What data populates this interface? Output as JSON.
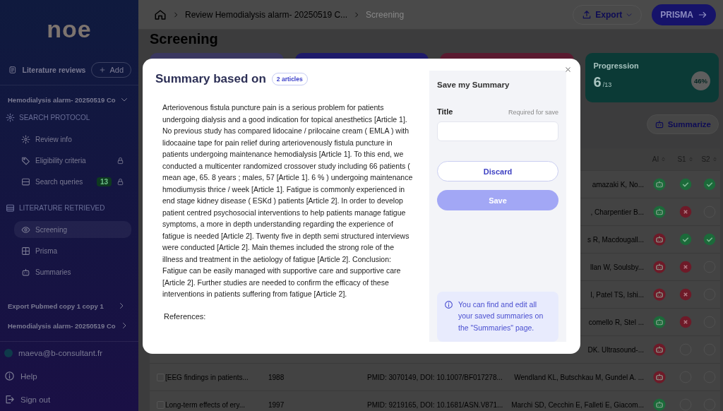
{
  "sidebar": {
    "logo": "noe",
    "reviews_label": "Literature reviews",
    "add_button": "Add",
    "current_review": {
      "title": "Hemodialysis alarm- 20250519 Co",
      "expanded": true,
      "sections": [
        {
          "heading": "SEARCH PROTOCOL",
          "items": [
            {
              "label": "Review info",
              "selected": false,
              "locked": false
            },
            {
              "label": "Eligibility criteria",
              "selected": false,
              "locked": true
            },
            {
              "label": "Search queries",
              "badge": "13",
              "selected": false,
              "locked": true
            }
          ]
        },
        {
          "heading": "LITERATURE RETRIEVED",
          "items": [
            {
              "label": "Screening",
              "selected": true,
              "locked": false
            },
            {
              "label": "Prisma",
              "selected": false,
              "locked": false
            },
            {
              "label": "Summaries",
              "selected": false,
              "locked": false
            }
          ]
        }
      ]
    },
    "other_reviews": [
      {
        "title": "Export Pubmed copy 1 copy 1",
        "expanded": false
      },
      {
        "title": "Hemodialysis alarm- 20250519 Co",
        "expanded": false
      }
    ],
    "user": "maeva@b-consultant.fr",
    "links": [
      "Help",
      "Sign out"
    ]
  },
  "topbar": {
    "breadcrumb": [
      "Review Hemodialysis alarm- 20250519 C...",
      "Screening"
    ],
    "export_button": "Export",
    "prisma_button": "PRISMA"
  },
  "page_title": "Screening",
  "stat_cards": [
    {
      "color": "#3a3760"
    },
    {
      "color": "#1e1a6a"
    },
    {
      "color": "#5a1a30"
    },
    {
      "color": "#0b3a36",
      "label": "Progression",
      "value": "6",
      "total": "/13",
      "percent": "46%"
    }
  ],
  "summarize_button": "Summarize",
  "table": {
    "columns": [
      "AI",
      "S1",
      "S2"
    ],
    "rows": [
      {
        "authors": "amazaki K, No...",
        "verdicts": [
          {
            "kind": "include"
          },
          {
            "kind": "include"
          },
          {
            "kind": "include"
          }
        ]
      },
      {
        "authors": ", Charpentier B...",
        "verdicts": [
          {
            "kind": "include"
          },
          {
            "kind": "exclude"
          },
          {
            "kind": "none"
          }
        ]
      },
      {
        "authors": "s R, Macdougall...",
        "verdicts": [
          {
            "kind": "exclude"
          },
          {
            "kind": "include"
          },
          {
            "kind": "include"
          }
        ]
      },
      {
        "authors": "llan W, Soulsby...",
        "verdicts": [
          {
            "kind": "exclude"
          },
          {
            "kind": "exclude"
          },
          {
            "kind": "none"
          }
        ]
      },
      {
        "authors": "l, Patel TS, Ishi...",
        "verdicts": [
          {
            "kind": "exclude"
          },
          {
            "kind": "exclude"
          },
          {
            "kind": "none"
          }
        ]
      },
      {
        "authors": "comello R, Stel ...",
        "verdicts": [
          {
            "kind": "include"
          },
          {
            "kind": "exclude"
          },
          {
            "kind": "none"
          }
        ]
      },
      {
        "authors": "DK. Ultrasound-...",
        "verdicts": [
          {
            "kind": "exclude"
          },
          {
            "kind": "none"
          },
          {
            "kind": "none"
          }
        ]
      },
      {
        "checked": false,
        "title": "[EEG findings in patients...",
        "year": "1988",
        "ids": "PMID: 3070149, DOI: 10.1007/BF017278...",
        "authors": "Wendland KL, Butschkau M, Gundel A. ...",
        "verdicts": [
          {
            "kind": "exclude"
          },
          {
            "kind": "none"
          },
          {
            "kind": "none"
          }
        ]
      },
      {
        "checked": false,
        "title": "Long-term effects of ery...",
        "year": "1997",
        "ids": "PMID: 9219165, DOI: 10.1681/ASN.V871...",
        "authors": "Marchi SD, Cecchin E, Falleti E, Giacom...",
        "verdicts": [
          {
            "kind": "include"
          },
          {
            "kind": "none"
          },
          {
            "kind": "none"
          }
        ]
      }
    ]
  },
  "modal": {
    "title": "Summary based on",
    "badge": "2 articles",
    "summary": "Arteriovenous fistula puncture pain is a serious problem for patients undergoing dialysis and a good indication for topical anesthetics [Article 1]. No previous study has compared lidocaine / prilocaine cream ( EMLA ) with lidocaaine tape for pain relief during arteriovenously fistula puncture in patients undergoing maintenance hemodialysis [Article 1]. To this end, we conducted a multicenter randomized crossover study including 66 patients ( mean age, 65. 8 years ; males, 57 [Article 1]. 6 % ) undergoing maintenance hmodiumysis thrice / week [Article 1]. Fatigue is commonly experienced in end stage kidney disease ( ESKd ) patients [Article 2]. In order to develop patient centred psychosocial interventions to help patients manage fatigue symptoms, a more in depth understanding regarding the experience of fatigue is needed [Article 2]. Twenty five in depth semi structured interviews were conducted [Article 2]. Main themes included the strong role of the illness and treatment in the aetiology of fatigue [Article 2]. Conclusion: Fatigue can be easily managed with supportive care and supportive care [Article 2]. Further studies are needed to confirm the efficacy of these interventions in patients suffering from fatigue [Article 2].",
    "references_heading": "References:",
    "save_panel": {
      "heading": "Save my Summary",
      "field_label": "Title",
      "field_hint": "Required for save",
      "discard_button": "Discard",
      "save_button": "Save",
      "save_disabled": true,
      "info": "You can find and edit all your saved summaries on the \"Summaries\" page."
    }
  }
}
